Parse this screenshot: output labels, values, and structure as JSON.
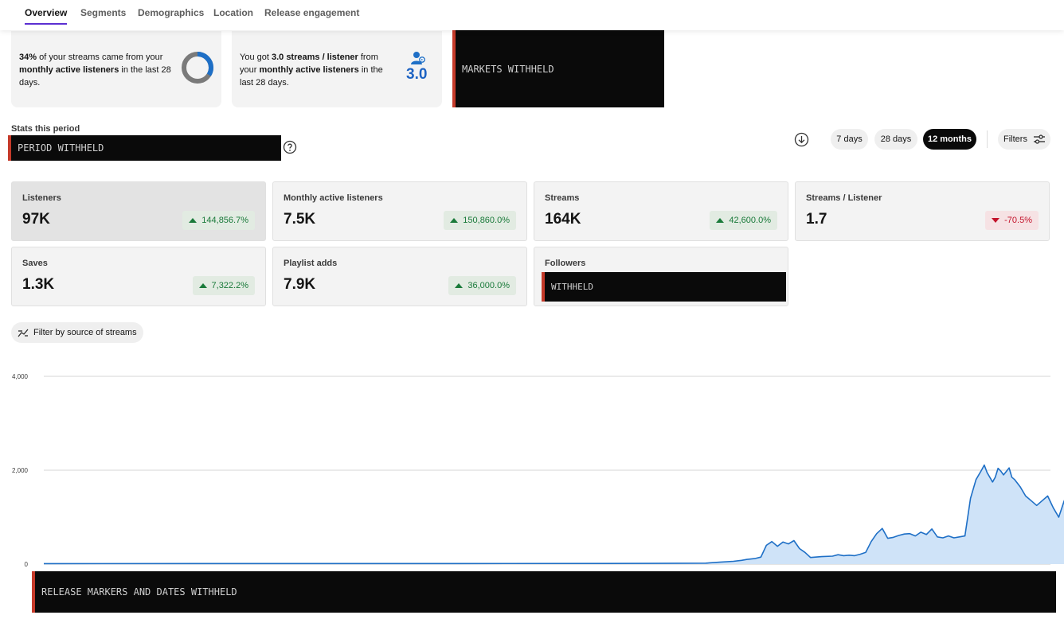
{
  "nav": {
    "tabs": [
      {
        "label": "Overview",
        "active": true
      },
      {
        "label": "Segments",
        "active": false
      },
      {
        "label": "Demographics",
        "active": false
      },
      {
        "label": "Location",
        "active": false
      },
      {
        "label": "Release engagement",
        "active": false
      }
    ]
  },
  "insights": {
    "streams_share": {
      "percent": "34%",
      "text_1": " of your streams came from your",
      "bold_2": "monthly active listeners",
      "text_2": " in the last 28",
      "text_3": "days.",
      "donut_fraction": 0.34
    },
    "streams_per_listener": {
      "text_1": "You got ",
      "bold_1": "3.0 streams / listener",
      "text_2": " from",
      "text_3": "your ",
      "bold_3": "monthly active listeners",
      "text_4": " in the",
      "text_5": "last 28 days.",
      "value": "3.0",
      "icon": "listener-icon"
    },
    "markets_redacted": "MARKETS WITHHELD"
  },
  "stats": {
    "label": "Stats this period",
    "period_redacted": "PERIOD WITHHELD",
    "ranges": [
      {
        "label": "7 days",
        "active": false
      },
      {
        "label": "28 days",
        "active": false
      },
      {
        "label": "12 months",
        "active": true
      }
    ],
    "filters_label": "Filters"
  },
  "metrics": [
    {
      "label": "Listeners",
      "value": "97K",
      "change": "144,856.7%",
      "direction": "up",
      "selected": true
    },
    {
      "label": "Monthly active listeners",
      "value": "7.5K",
      "change": "150,860.0%",
      "direction": "up",
      "selected": false
    },
    {
      "label": "Streams",
      "value": "164K",
      "change": "42,600.0%",
      "direction": "up",
      "selected": false
    },
    {
      "label": "Streams / Listener",
      "value": "1.7",
      "change": "-70.5%",
      "direction": "down",
      "selected": false
    },
    {
      "label": "Saves",
      "value": "1.3K",
      "change": "7,322.2%",
      "direction": "up",
      "selected": false
    },
    {
      "label": "Playlist adds",
      "value": "7.9K",
      "change": "36,000.0%",
      "direction": "up",
      "selected": false
    },
    {
      "label": "Followers",
      "value_redacted": "WITHHELD"
    }
  ],
  "filter_source_label": "Filter by source of streams",
  "release_redacted": "RELEASE MARKERS AND DATES WITHHELD",
  "colors": {
    "accent": "#5b2fd1",
    "line": "#1e6fc6",
    "area": "#cfe3f8",
    "up": "#1a7a3a",
    "down": "#c3132b"
  },
  "chart_data": {
    "type": "area",
    "ylim": [
      0,
      4000
    ],
    "yticks": [
      "4,000",
      "2,000",
      "0"
    ],
    "yticks_values": [
      4000,
      2000,
      0
    ],
    "x_days": 365,
    "series": [
      {
        "points": [
          [
            0,
            10
          ],
          [
            150,
            12
          ],
          [
            220,
            15
          ],
          [
            240,
            20
          ],
          [
            245,
            40
          ],
          [
            250,
            60
          ],
          [
            253,
            80
          ],
          [
            255,
            100
          ],
          [
            258,
            120
          ],
          [
            260,
            150
          ],
          [
            262,
            400
          ],
          [
            264,
            480
          ],
          [
            266,
            380
          ],
          [
            268,
            470
          ],
          [
            270,
            430
          ],
          [
            272,
            500
          ],
          [
            274,
            330
          ],
          [
            276,
            250
          ],
          [
            278,
            140
          ],
          [
            282,
            160
          ],
          [
            286,
            170
          ],
          [
            288,
            200
          ],
          [
            290,
            180
          ],
          [
            292,
            190
          ],
          [
            294,
            180
          ],
          [
            296,
            210
          ],
          [
            298,
            250
          ],
          [
            300,
            480
          ],
          [
            302,
            650
          ],
          [
            304,
            760
          ],
          [
            306,
            550
          ],
          [
            308,
            570
          ],
          [
            310,
            610
          ],
          [
            312,
            640
          ],
          [
            314,
            650
          ],
          [
            316,
            600
          ],
          [
            318,
            680
          ],
          [
            320,
            630
          ],
          [
            322,
            750
          ],
          [
            324,
            580
          ],
          [
            326,
            560
          ],
          [
            328,
            600
          ],
          [
            330,
            560
          ],
          [
            332,
            580
          ],
          [
            334,
            600
          ],
          [
            336,
            1400
          ],
          [
            338,
            1800
          ],
          [
            340,
            2000
          ],
          [
            341,
            2110
          ],
          [
            342,
            1950
          ],
          [
            344,
            1750
          ],
          [
            345,
            1850
          ],
          [
            346,
            2040
          ],
          [
            347,
            1980
          ],
          [
            348,
            1900
          ],
          [
            350,
            2050
          ],
          [
            351,
            1850
          ],
          [
            352,
            1800
          ],
          [
            354,
            1650
          ],
          [
            356,
            1450
          ],
          [
            358,
            1350
          ],
          [
            360,
            1250
          ],
          [
            362,
            1350
          ],
          [
            364,
            1450
          ],
          [
            366,
            1200
          ],
          [
            368,
            1000
          ],
          [
            370,
            1350
          ],
          [
            372,
            1550
          ],
          [
            374,
            1450
          ],
          [
            376,
            1250
          ],
          [
            378,
            1150
          ],
          [
            380,
            1300
          ],
          [
            382,
            1250
          ],
          [
            384,
            1100
          ],
          [
            386,
            1300
          ],
          [
            388,
            1450
          ],
          [
            390,
            1300
          ],
          [
            392,
            1350
          ],
          [
            394,
            1250
          ],
          [
            396,
            1000
          ],
          [
            398,
            1150
          ],
          [
            400,
            1300
          ],
          [
            402,
            1400
          ],
          [
            404,
            1600
          ],
          [
            405,
            1900
          ],
          [
            406,
            2300
          ],
          [
            407,
            2450
          ],
          [
            408,
            2350
          ],
          [
            409,
            2450
          ],
          [
            410,
            2250
          ],
          [
            411,
            2100
          ],
          [
            412,
            2200
          ],
          [
            414,
            2300
          ],
          [
            416,
            2100
          ],
          [
            418,
            2350
          ],
          [
            420,
            2450
          ],
          [
            422,
            2300
          ],
          [
            424,
            2000
          ],
          [
            426,
            1800
          ],
          [
            428,
            1850
          ],
          [
            430,
            1800
          ],
          [
            432,
            1950
          ],
          [
            434,
            2100
          ],
          [
            435,
            2300
          ],
          [
            436,
            2450
          ],
          [
            437,
            2150
          ],
          [
            438,
            1500
          ],
          [
            440,
            1200
          ],
          [
            442,
            1000
          ],
          [
            444,
            1150
          ],
          [
            446,
            1050
          ],
          [
            448,
            1100
          ],
          [
            450,
            1000
          ],
          [
            452,
            1500
          ],
          [
            454,
            2200
          ],
          [
            455,
            2150
          ],
          [
            456,
            1700
          ],
          [
            457,
            700
          ],
          [
            458,
            1350
          ],
          [
            459,
            2000
          ],
          [
            460,
            1600
          ],
          [
            461,
            1000
          ],
          [
            462,
            1300
          ],
          [
            464,
            1500
          ],
          [
            466,
            1550
          ]
        ]
      }
    ]
  }
}
